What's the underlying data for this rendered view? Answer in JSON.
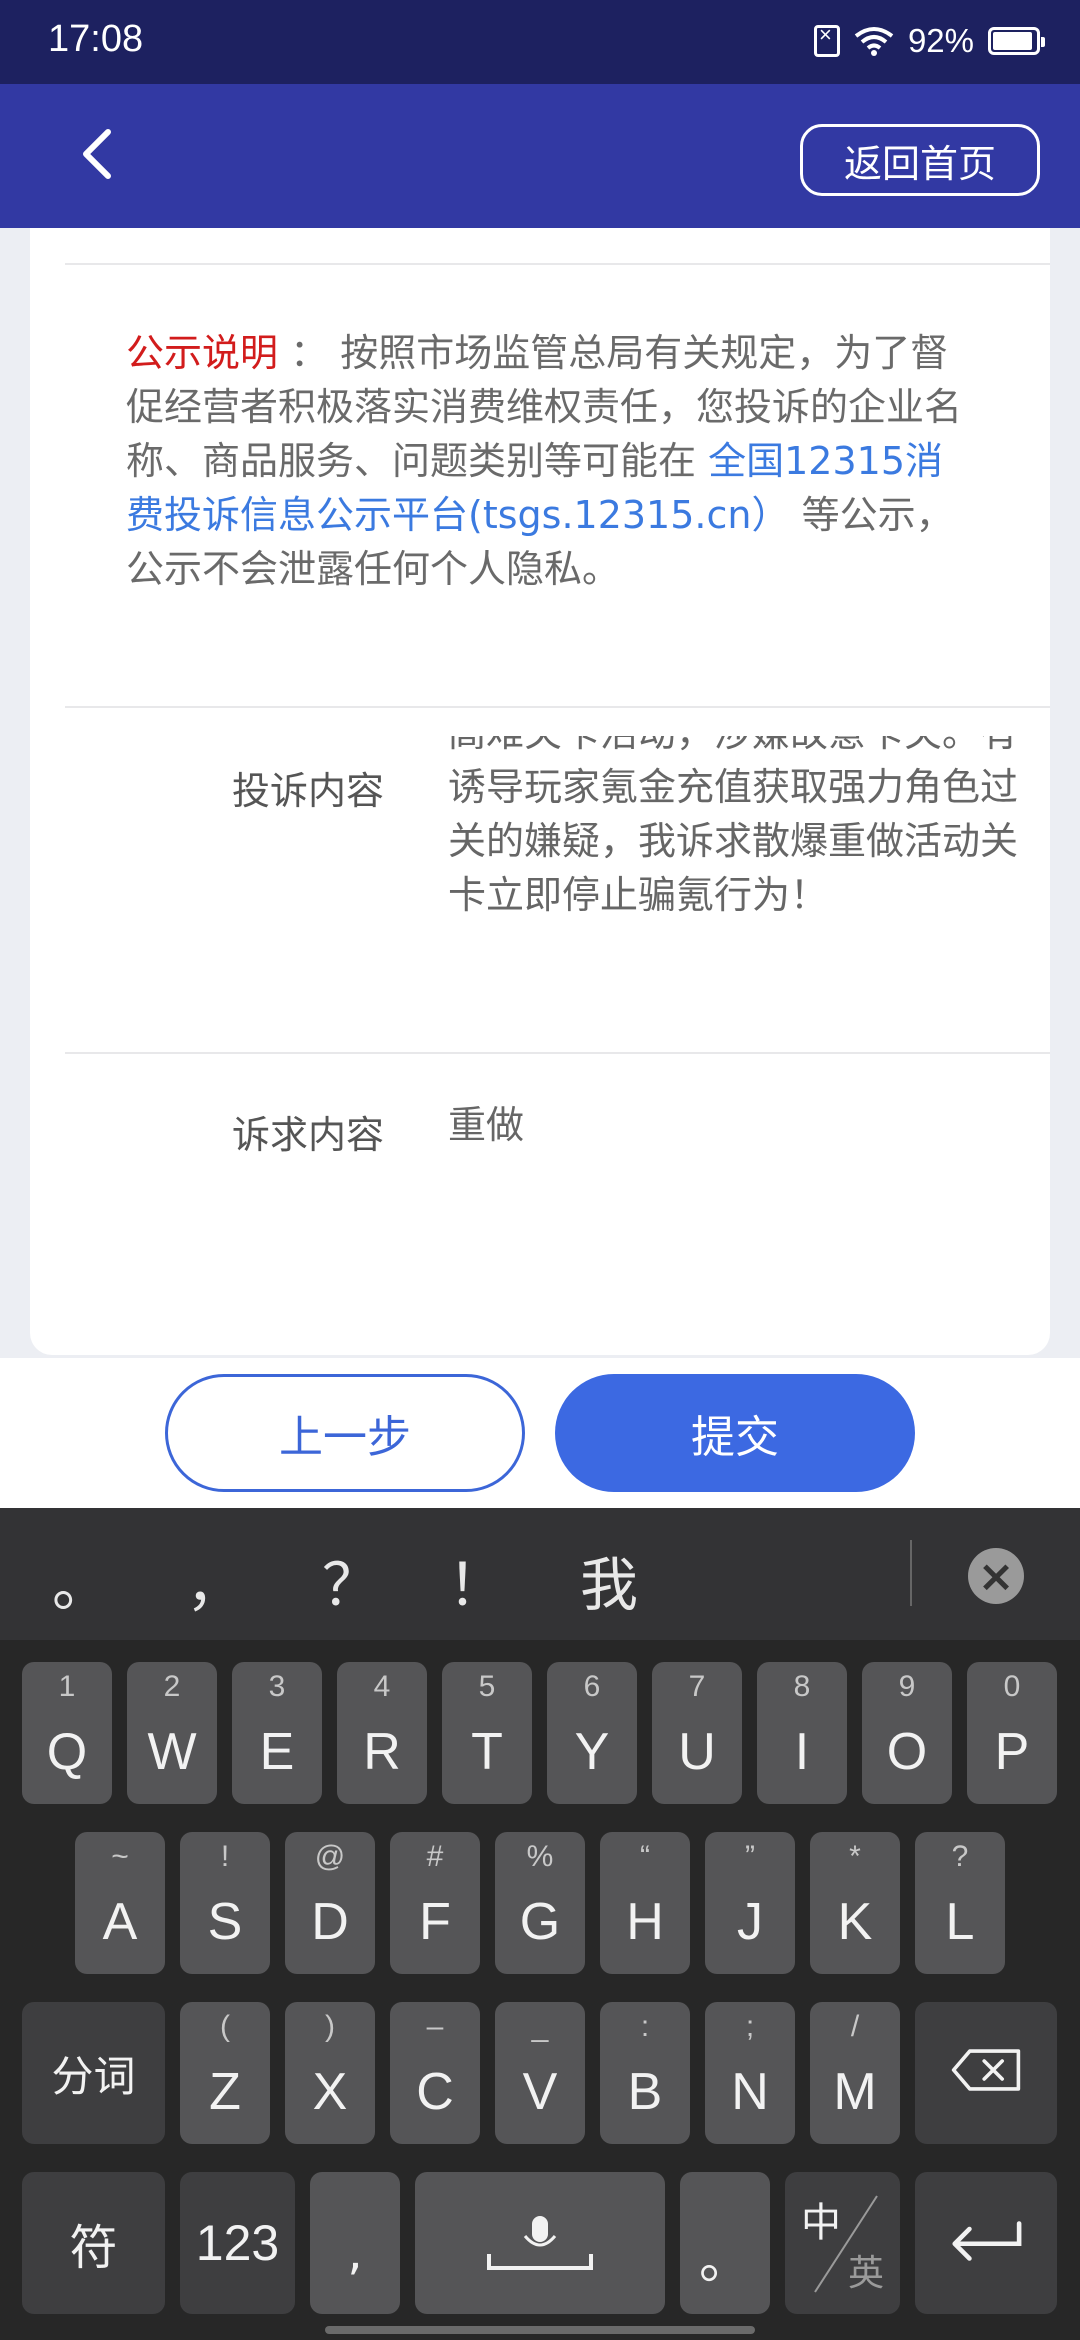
{
  "status_bar": {
    "time": "17:08",
    "battery": "92%"
  },
  "nav": {
    "home_label": "返回首页"
  },
  "notice": {
    "label": "公示说明",
    "colon": "：",
    "text1": "按照市场监管总局有关规定，为了督促经营者积极落实消费维权责任，您投诉的企业名称、商品服务、问题类别等可能在",
    "link": "全国12315消费投诉信息公示平台(tsgs.12315.cn）",
    "text2": "等公示，公示不会泄露任何个人隐私。"
  },
  "complaint": {
    "label": "投诉内容",
    "value": "高难关卡活动，涉嫌故意卡关。有诱导玩家氪金充值获取强力角色过关的嫌疑，我诉求散爆重做活动关卡立即停止骗氪行为！"
  },
  "claim": {
    "label": "诉求内容",
    "value": "重做"
  },
  "actions": {
    "prev_label": "上一步",
    "submit_label": "提交"
  },
  "keyboard": {
    "candidates": [
      "。",
      "，",
      "？",
      "！",
      "我"
    ],
    "row1": [
      {
        "main": "Q",
        "sub": "1"
      },
      {
        "main": "W",
        "sub": "2"
      },
      {
        "main": "E",
        "sub": "3"
      },
      {
        "main": "R",
        "sub": "4"
      },
      {
        "main": "T",
        "sub": "5"
      },
      {
        "main": "Y",
        "sub": "6"
      },
      {
        "main": "U",
        "sub": "7"
      },
      {
        "main": "I",
        "sub": "8"
      },
      {
        "main": "O",
        "sub": "9"
      },
      {
        "main": "P",
        "sub": "0"
      }
    ],
    "row2": [
      {
        "main": "A",
        "sub": "~"
      },
      {
        "main": "S",
        "sub": "!"
      },
      {
        "main": "D",
        "sub": "@"
      },
      {
        "main": "F",
        "sub": "#"
      },
      {
        "main": "G",
        "sub": "%"
      },
      {
        "main": "H",
        "sub": "“"
      },
      {
        "main": "J",
        "sub": "”"
      },
      {
        "main": "K",
        "sub": "*"
      },
      {
        "main": "L",
        "sub": "?"
      }
    ],
    "row3": [
      {
        "main": "Z",
        "sub": "("
      },
      {
        "main": "X",
        "sub": ")"
      },
      {
        "main": "C",
        "sub": "–"
      },
      {
        "main": "V",
        "sub": "_"
      },
      {
        "main": "B",
        "sub": ":"
      },
      {
        "main": "N",
        "sub": ";"
      },
      {
        "main": "M",
        "sub": "/"
      }
    ],
    "segment_label": "分词",
    "symbols_label": "符",
    "numbers_label": "123",
    "comma_label": ",",
    "period_label": "。",
    "lang_zh": "中",
    "lang_en": "英"
  }
}
